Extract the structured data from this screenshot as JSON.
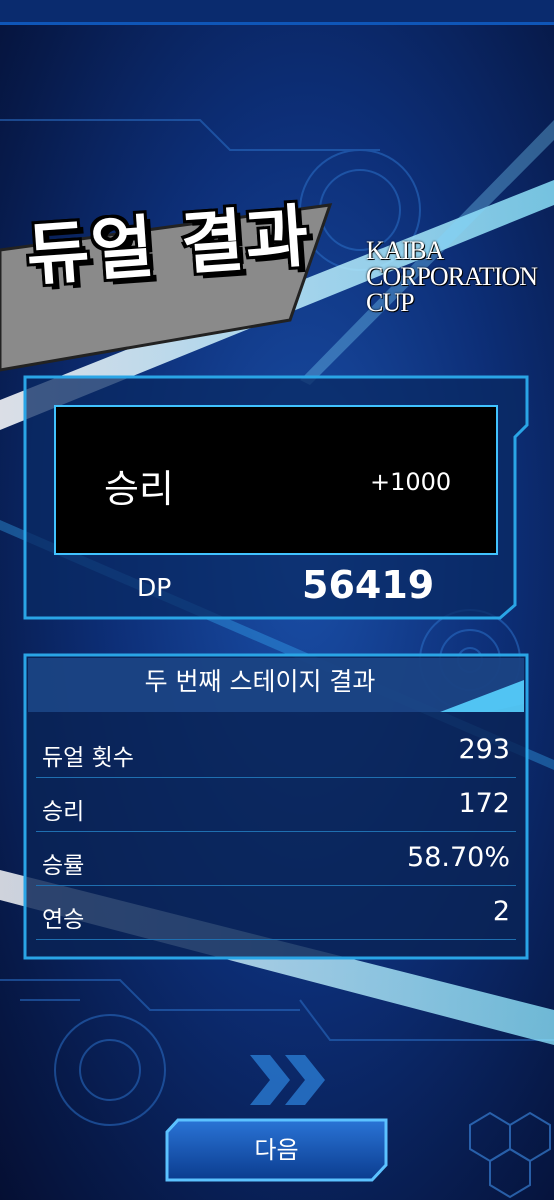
{
  "title": "듀얼 결과",
  "event_logo": [
    "KAIBA",
    "CORPORATION",
    "CUP"
  ],
  "result": {
    "label": "승리",
    "dp_change": "+1000",
    "dp_label": "DP",
    "dp_value": "56419"
  },
  "stage": {
    "title": "두 번째 스테이지 결과",
    "rows": [
      {
        "label": "듀얼 횟수",
        "value": "293"
      },
      {
        "label": "승리",
        "value": "172"
      },
      {
        "label": "승률",
        "value": "58.70%"
      },
      {
        "label": "연승",
        "value": "2"
      }
    ]
  },
  "next_button": {
    "label": "다음"
  },
  "colors": {
    "accent": "#41c3ff",
    "panel_border": "#2aa5e6",
    "background": "#0d2f78"
  }
}
